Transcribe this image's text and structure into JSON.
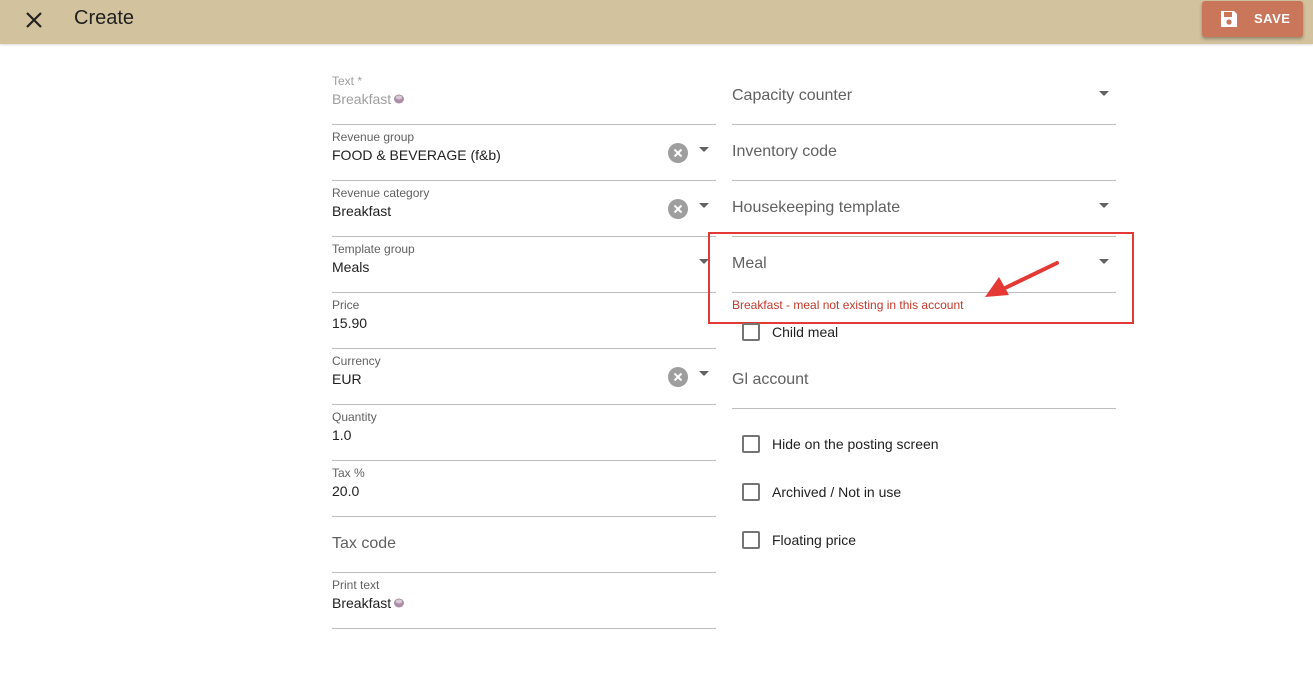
{
  "header": {
    "close_icon": "close-icon",
    "title": "Create",
    "save_label": "SAVE",
    "save_icon": "floppy-disk-icon",
    "bar_color": "#d2c29e",
    "save_color": "#c9765a"
  },
  "left": {
    "text": {
      "label": "Text *",
      "value": "Breakfast",
      "icon": "coffee-cup-icon"
    },
    "revenue_group": {
      "label": "Revenue group",
      "value": "FOOD & BEVERAGE (f&b)"
    },
    "revenue_category": {
      "label": "Revenue category",
      "value": "Breakfast"
    },
    "template_group": {
      "label": "Template group",
      "value": "Meals"
    },
    "price": {
      "label": "Price",
      "value": "15.90"
    },
    "currency": {
      "label": "Currency",
      "value": "EUR"
    },
    "quantity": {
      "label": "Quantity",
      "value": "1.0"
    },
    "tax": {
      "label": "Tax %",
      "value": "20.0"
    },
    "tax_code": {
      "placeholder": "Tax code"
    },
    "print_text": {
      "label": "Print text",
      "value": "Breakfast",
      "icon": "coffee-cup-icon"
    }
  },
  "right": {
    "capacity_counter": {
      "placeholder": "Capacity counter"
    },
    "inventory_code": {
      "placeholder": "Inventory code"
    },
    "housekeeping_template": {
      "placeholder": "Housekeeping template"
    },
    "meal": {
      "placeholder": "Meal",
      "error": "Breakfast - meal not existing in this account"
    },
    "child_meal": {
      "label": "Child meal",
      "checked": false
    },
    "gl_account": {
      "placeholder": "Gl account"
    },
    "hide_posting": {
      "label": "Hide on the posting screen",
      "checked": false
    },
    "archived": {
      "label": "Archived / Not in use",
      "checked": false
    },
    "floating_price": {
      "label": "Floating price",
      "checked": false
    }
  },
  "colors": {
    "error": "#c0392b",
    "highlight": "#e53935"
  }
}
